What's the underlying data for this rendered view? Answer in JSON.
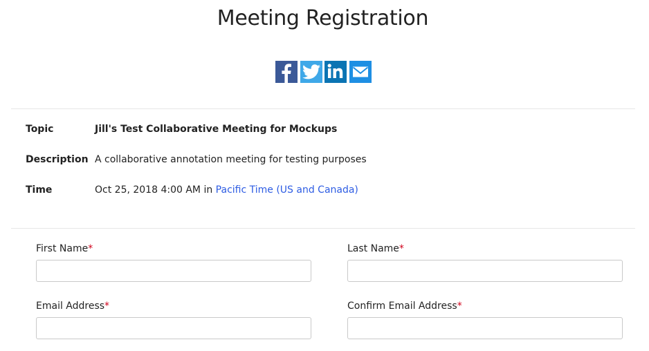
{
  "page": {
    "title": "Meeting Registration"
  },
  "share": [
    {
      "name": "facebook-icon",
      "glyph": "f",
      "color": "#3b5998"
    },
    {
      "name": "twitter-icon",
      "color": "#3fa8e8"
    },
    {
      "name": "linkedin-icon",
      "glyph": "in",
      "color": "#0b74b3"
    },
    {
      "name": "email-icon",
      "color": "#1e8fe3"
    }
  ],
  "meeting": {
    "topic_label": "Topic",
    "topic": "Jill's Test Collaborative Meeting for Mockups",
    "description_label": "Description",
    "description": "A collaborative annotation meeting for testing purposes",
    "time_label": "Time",
    "time_value": "Oct 25, 2018 4:00 AM",
    "time_in": "in",
    "timezone": "Pacific Time (US and Canada)"
  },
  "form": {
    "required_mark": "*",
    "first_name": {
      "label": "First Name",
      "value": ""
    },
    "last_name": {
      "label": "Last Name",
      "value": ""
    },
    "email": {
      "label": "Email Address",
      "value": ""
    },
    "confirm_email": {
      "label": "Confirm Email Address",
      "value": ""
    }
  },
  "colors": {
    "link": "#2d5ce3",
    "required": "#d0021b",
    "divider": "#e6e6e6"
  }
}
